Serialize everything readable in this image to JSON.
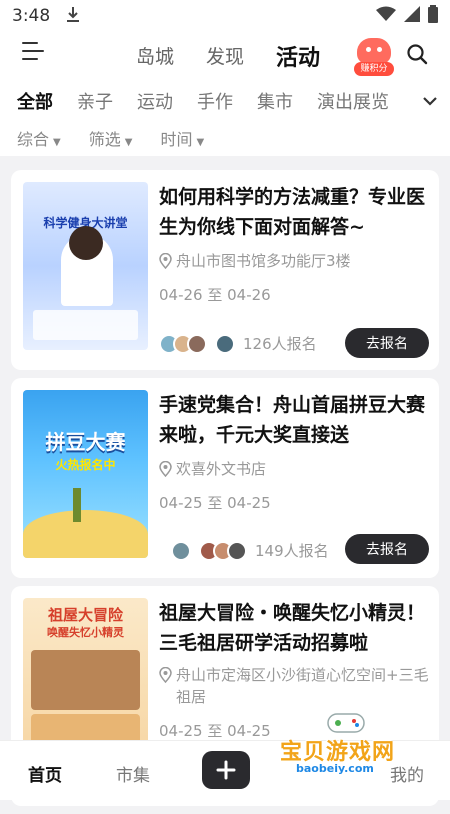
{
  "status": {
    "time": "3:48"
  },
  "header": {
    "tabs": [
      {
        "label": "岛城"
      },
      {
        "label": "发现"
      },
      {
        "label": "活动"
      }
    ],
    "points_label": "赚积分"
  },
  "categories": [
    "全部",
    "亲子",
    "运动",
    "手作",
    "集市",
    "演出展览"
  ],
  "filters": [
    "综合",
    "筛选",
    "时间"
  ],
  "events": [
    {
      "title": "如何用科学的方法减重？专业医生为你线下面对面解答~",
      "location": "舟山市图书馆多功能厅3楼",
      "dates": "04-26 至 04-26",
      "signups": "126人报名",
      "button": "去报名",
      "poster_title": "科学健身大讲堂"
    },
    {
      "title": "手速党集合！舟山首届拼豆大赛来啦，千元大奖直接送",
      "location": "欢喜外文书店",
      "dates": "04-25 至 04-25",
      "signups": "149人报名",
      "button": "去报名",
      "poster_title": "拼豆大赛",
      "poster_sub": "火热报名中"
    },
    {
      "title": "祖屋大冒险・唤醒失忆小精灵！三毛祖居研学活动招募啦",
      "location": "舟山市定海区小沙街道心忆空间+三毛祖居",
      "dates": "04-25 至 04-25",
      "poster_title": "祖屋大冒险",
      "poster_sub": "唤醒失忆小精灵"
    }
  ],
  "bottom_nav": [
    {
      "label": "首页"
    },
    {
      "label": "市集"
    },
    {
      "label": "我的"
    }
  ],
  "watermark": {
    "text": "宝贝游戏网",
    "url": "baobeiy.com"
  },
  "colors": {
    "accent_dark": "#2a2a2e",
    "points_red": "#ff4d3d"
  }
}
